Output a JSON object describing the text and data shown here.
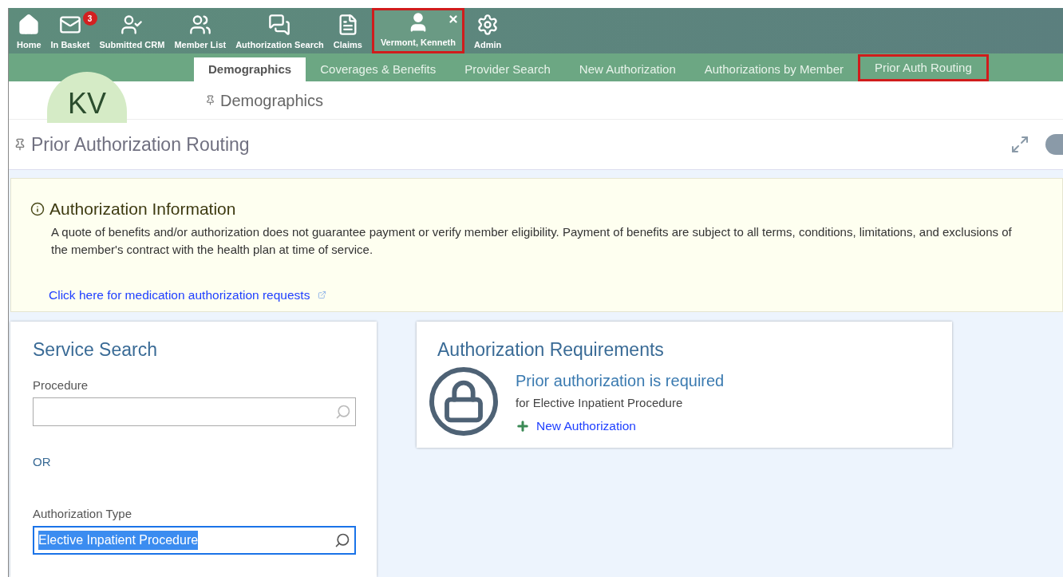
{
  "nav": {
    "items": [
      {
        "kind": "home",
        "label": "Home",
        "highlighted": false
      },
      {
        "kind": "inbox",
        "label": "In Basket",
        "badge": "3",
        "highlighted": false
      },
      {
        "kind": "crm",
        "label": "Submitted CRM",
        "highlighted": false
      },
      {
        "kind": "members",
        "label": "Member List",
        "highlighted": false
      },
      {
        "kind": "authsearch",
        "label": "Authorization Search",
        "highlighted": false
      },
      {
        "kind": "claims",
        "label": "Claims",
        "highlighted": false
      },
      {
        "kind": "person",
        "label": "Vermont, Kenneth",
        "highlighted": true,
        "closable": true
      },
      {
        "kind": "admin",
        "label": "Admin",
        "highlighted": false
      }
    ]
  },
  "avatar": {
    "initials": "KV"
  },
  "tabs": [
    {
      "label": "Demographics",
      "selected": true,
      "highlighted": false
    },
    {
      "label": "Coverages & Benefits",
      "selected": false,
      "highlighted": false
    },
    {
      "label": "Provider Search",
      "selected": false,
      "highlighted": false
    },
    {
      "label": "New Authorization",
      "selected": false,
      "highlighted": false
    },
    {
      "label": "Authorizations by Member",
      "selected": false,
      "highlighted": false
    },
    {
      "label": "Prior Auth Routing",
      "selected": false,
      "highlighted": true
    }
  ],
  "section_title": "Demographics",
  "page_title": "Prior Authorization Routing",
  "info": {
    "title": "Authorization Information",
    "text": "A quote of benefits and/or authorization does not guarantee payment or verify member eligibility. Payment of benefits are subject to all terms, conditions, limitations, and exclusions of the member's contract with the health plan at time of service.",
    "link": "Click here for medication authorization requests"
  },
  "service_search": {
    "title": "Service Search",
    "procedure": {
      "label": "Procedure",
      "focused": false
    },
    "or": "OR",
    "auth_type": {
      "label": "Authorization Type",
      "value": "Elective Inpatient Procedure",
      "focused": true
    }
  },
  "requirements": {
    "title": "Authorization Requirements",
    "status": "Prior authorization is required",
    "detail": "for Elective Inpatient Procedure",
    "action": "New Authorization"
  }
}
